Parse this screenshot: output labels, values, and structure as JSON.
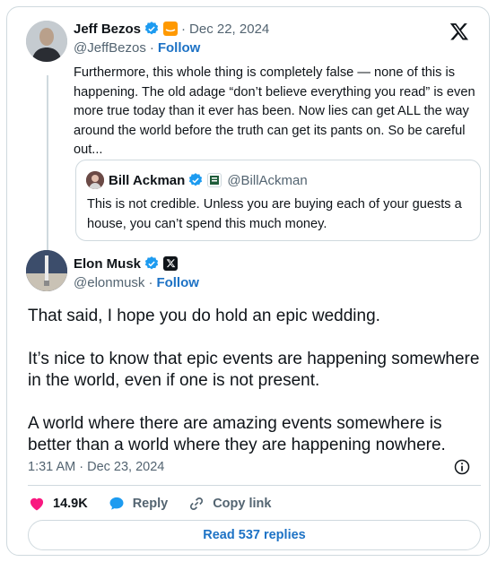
{
  "tweet_original": {
    "author_name": "Jeff Bezos",
    "handle": "@JeffBezos",
    "date": "Dec 22, 2024",
    "follow_label": "Follow",
    "text": "Furthermore, this whole thing is completely false — none of this is happening. The old adage “don’t believe everything you read” is even more true today than it ever has been. Now lies can get ALL the way around the world before the truth can get its pants on. So be careful out..."
  },
  "quoted": {
    "author_name": "Bill Ackman",
    "handle": "@BillAckman",
    "text": "This is not credible. Unless you are buying each of your guests a house, you can’t spend this much money."
  },
  "tweet_reply": {
    "author_name": "Elon Musk",
    "handle": "@elonmusk",
    "follow_label": "Follow",
    "paragraphs": [
      "That said, I hope you do hold an epic wedding.",
      "It’s nice to know that epic events are happening somewhere in the world, even if one is not present.",
      "A world where there are amazing events somewhere is better than a world where they are happening nowhere."
    ],
    "time": "1:31 AM",
    "date": "Dec 23, 2024"
  },
  "actions": {
    "likes": "14.9K",
    "reply_label": "Reply",
    "copy_link_label": "Copy link",
    "read_replies_label": "Read 537 replies"
  },
  "colors": {
    "link": "#1d72c5",
    "verified": "#1d9bf0",
    "like": "#f91880",
    "muted": "#536471",
    "border": "#cfd9de"
  },
  "icons": [
    "x-logo-icon",
    "verified-badge-icon",
    "amazon-affiliate-icon",
    "affiliate-badge-icon",
    "x-affiliate-icon",
    "heart-icon",
    "reply-bubble-icon",
    "link-icon",
    "info-icon"
  ]
}
